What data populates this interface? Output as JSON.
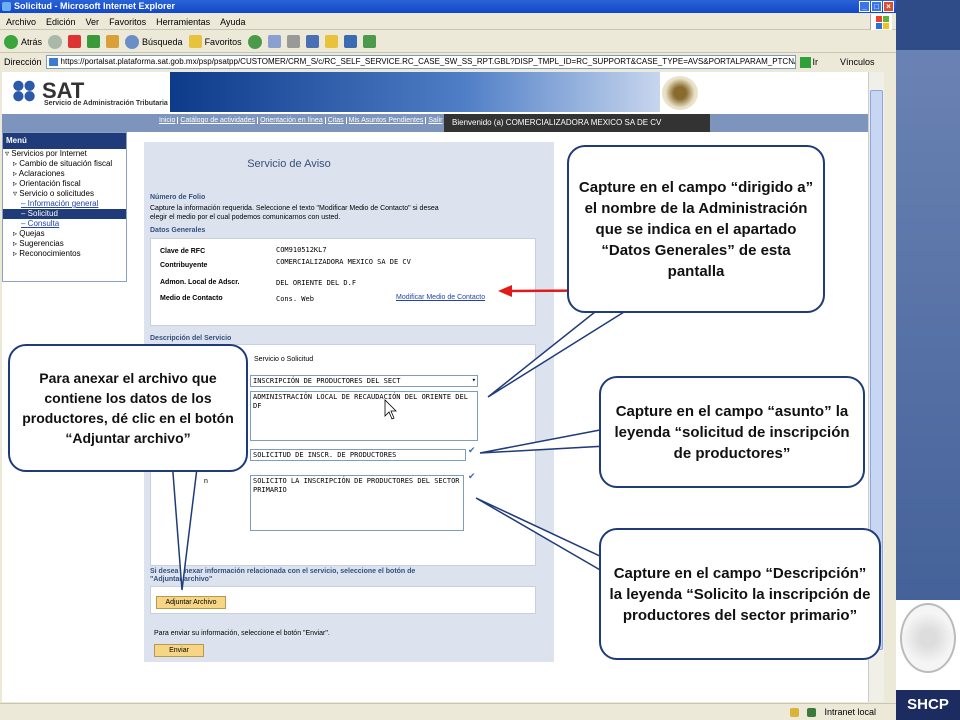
{
  "window": {
    "title": "Solicitud - Microsoft Internet Explorer",
    "menu": [
      "Archivo",
      "Edición",
      "Ver",
      "Favoritos",
      "Herramientas",
      "Ayuda"
    ],
    "toolbar": {
      "back": "Atrás",
      "search": "Búsqueda",
      "favorites": "Favoritos"
    },
    "address_label": "Dirección",
    "address": "https://portalsat.plataforma.sat.gob.mx/psp/psatpp/CUSTOMER/CRM_S/c/RC_SELF_SERVICE.RC_CASE_SW_SS_RPT.GBL?DISP_TMPL_ID=RC_SUPPORT&CASE_TYPE=AVS&PORTALPARAM_PTCNAV=SAT_RC_CASE_SV",
    "go": "Ir",
    "links": "Vínculos",
    "status": "Intranet local"
  },
  "header": {
    "logo": "SAT",
    "subtitle": "Servicio de Administración Tributaria",
    "nav": [
      "Inicio",
      "Catálogo de actividades",
      "Orientación en línea",
      "Citas",
      "Mis Asuntos Pendientes",
      "Salir"
    ],
    "welcome": "Bienvenido (a) COMERCIALIZADORA MEXICO SA DE CV"
  },
  "menu": {
    "title": "Menú",
    "items": [
      {
        "label": "Servicios por Internet",
        "type": "it"
      },
      {
        "label": "Cambio de situación fiscal",
        "type": "it2"
      },
      {
        "label": "Aclaraciones",
        "type": "it2"
      },
      {
        "label": "Orientación fiscal",
        "type": "it2"
      },
      {
        "label": "Servicio o solicitudes",
        "type": "it2"
      },
      {
        "label": "Información general",
        "type": "sub"
      },
      {
        "label": "Solicitud",
        "type": "sub-sel"
      },
      {
        "label": "Consulta",
        "type": "sub"
      },
      {
        "label": "Quejas",
        "type": "it2"
      },
      {
        "label": "Sugerencias",
        "type": "it2"
      },
      {
        "label": "Reconocimientos",
        "type": "it2"
      }
    ]
  },
  "form": {
    "title": "Servicio de Aviso",
    "folio_heading": "Número de Folio",
    "folio_text1": "Capture la información requerida. Seleccione el texto \"Modificar Medio de Contacto\" si desea",
    "folio_text2": "elegir el medio por el cual podemos comunicarnos con usted.",
    "datos_heading": "Datos Generales",
    "rfc_label": "Clave de RFC",
    "rfc_value": "COM910512KL7",
    "contrib_label": "Contribuyente",
    "contrib_value": "COMERCIALIZADORA MEXICO SA DE CV",
    "admon_label": "Admon. Local de Adscr.",
    "admon_value": "DEL ORIENTE DEL D.F",
    "medio_label": "Medio de Contacto",
    "medio_value": "Cons. Web",
    "modificar_link": "Modificar Medio de Contacto",
    "desc_heading": "Descripción del Servicio",
    "servicio_label": "Servicio o Solicitud",
    "servicio_value": "INSCRIPCIÓN DE PRODUCTORES DEL SECT",
    "dirigido_value": "ADMINISTRACIÓN LOCAL DE RECAUDACIÓN DEL ORIENTE DEL DF",
    "asunto_value": "SOLICITUD DE INSCR. DE PRODUCTORES",
    "descripcion_label_partial": "n",
    "descripcion_value": "SOLICITO LA INSCRIPCIÓN DE PRODUCTORES DEL SECTOR PRIMARIO",
    "anexar_text1": "Si desea anexar información relacionada con el servicio, seleccione el botón de",
    "anexar_text2": "\"Adjuntar archivo\"",
    "adjuntar_button": "Adjuntar Archivo",
    "enviar_text": "Para enviar su información, seleccione el botón \"Enviar\".",
    "enviar_button": "Enviar"
  },
  "callouts": {
    "dirigido": "Capture en el campo “dirigido a” el nombre de la Administración que se indica en el apartado “Datos Generales” de esta pantalla",
    "anexar": "Para anexar el archivo que contiene los datos de los productores, dé clic en el botón “Adjuntar archivo”",
    "asunto": "Capture en el campo “asunto” la leyenda “solicitud de inscripción de productores”",
    "descripcion": "Capture en el campo “Descripción” la leyenda “Solicito la inscripción de productores del sector primario”"
  },
  "branding": {
    "shcp": "SHCP"
  },
  "colors": {
    "accent": "#1f3b7a",
    "arrow": "#e11b1b",
    "button": "#f6d684"
  }
}
